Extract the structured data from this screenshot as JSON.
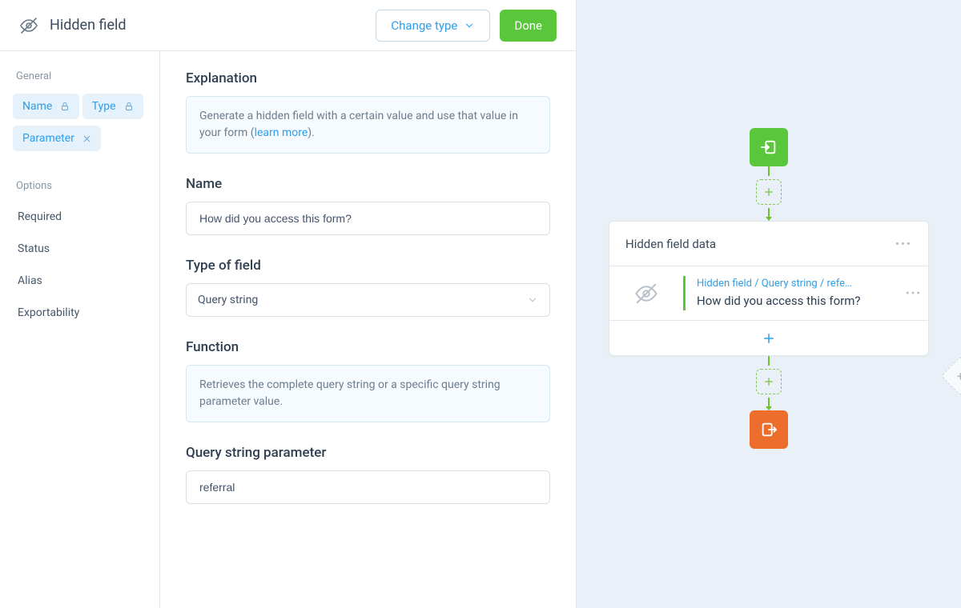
{
  "header": {
    "title": "Hidden field",
    "change_type_label": "Change type",
    "done_label": "Done"
  },
  "sidebar": {
    "section_general": "General",
    "section_options": "Options",
    "items_general": [
      {
        "label": "Name",
        "locked": true,
        "active": true
      },
      {
        "label": "Type",
        "locked": true,
        "active": true
      },
      {
        "label": "Parameter",
        "closable": true,
        "active": true
      }
    ],
    "items_options": [
      {
        "label": "Required"
      },
      {
        "label": "Status"
      },
      {
        "label": "Alias"
      },
      {
        "label": "Exportability"
      }
    ]
  },
  "content": {
    "explanation": {
      "title": "Explanation",
      "text_before": "Generate a hidden field with a certain value and use that value in your form (",
      "link_text": "learn more",
      "text_after": ")."
    },
    "name": {
      "title": "Name",
      "value": "How did you access this form?"
    },
    "type": {
      "title": "Type of field",
      "value": "Query string"
    },
    "function": {
      "title": "Function",
      "text": "Retrieves the complete query string or a specific query string parameter value."
    },
    "parameter": {
      "title": "Query string parameter",
      "value": "referral"
    }
  },
  "flow": {
    "card_title": "Hidden field data",
    "card_breadcrumb": "Hidden field / Query string / refe…",
    "card_question": "How did you access this form?"
  }
}
